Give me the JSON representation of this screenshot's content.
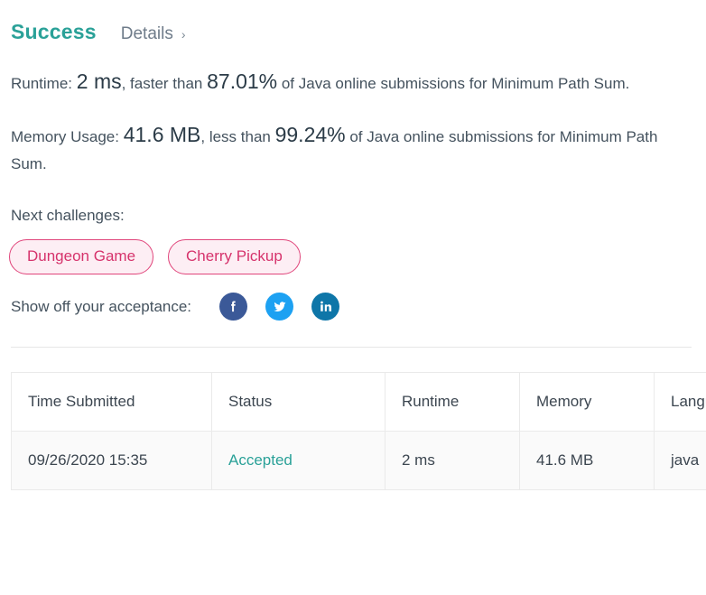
{
  "header": {
    "status_title": "Success",
    "details_label": "Details",
    "chevron": "›"
  },
  "stats": {
    "runtime": {
      "label": "Runtime:",
      "value": "2 ms",
      "comparator": ", faster than ",
      "percentile": "87.01%",
      "suffix": " of Java online submissions for Minimum Path Sum."
    },
    "memory": {
      "label": "Memory Usage:",
      "value": "41.6 MB",
      "comparator": ", less than ",
      "percentile": "99.24%",
      "suffix": " of Java online submissions for Minimum Path Sum."
    }
  },
  "next_challenges": {
    "label": "Next challenges:",
    "tags": [
      {
        "label": "Dungeon Game"
      },
      {
        "label": "Cherry Pickup"
      }
    ]
  },
  "share": {
    "label": "Show off your acceptance:",
    "networks": [
      {
        "name": "facebook",
        "icon": "facebook-icon",
        "color": "#3b5998"
      },
      {
        "name": "twitter",
        "icon": "twitter-icon",
        "color": "#1da1f2"
      },
      {
        "name": "linkedin",
        "icon": "linkedin-icon",
        "color": "#0e76a8"
      }
    ]
  },
  "submissions_table": {
    "columns": [
      "Time Submitted",
      "Status",
      "Runtime",
      "Memory",
      "Language"
    ],
    "rows": [
      {
        "time_submitted": "09/26/2020 15:35",
        "status": "Accepted",
        "runtime": "2 ms",
        "memory": "41.6 MB",
        "language": "java"
      }
    ]
  },
  "colors": {
    "success_teal": "#2aa198",
    "tag_pink": "#d6336c",
    "tag_pink_bg": "#fdeef4",
    "text_gray": "#44525e"
  }
}
